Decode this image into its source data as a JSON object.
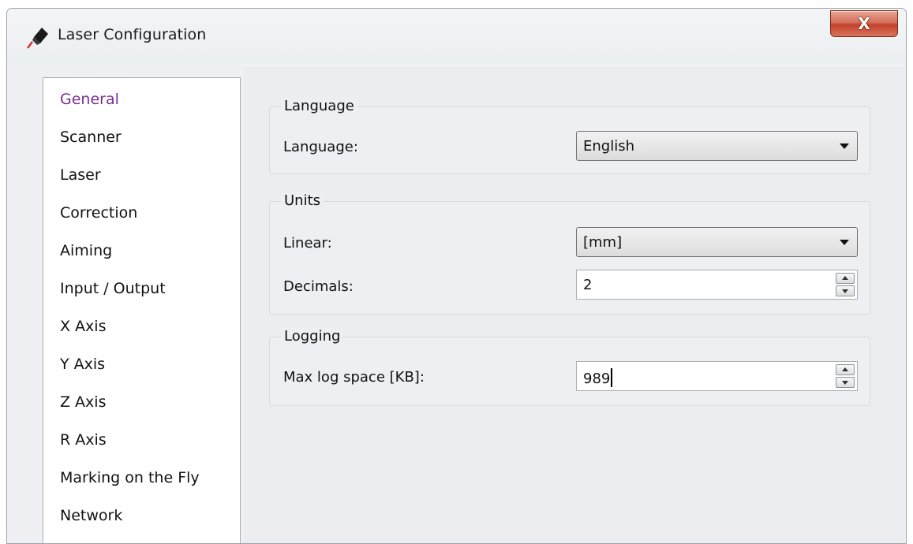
{
  "window": {
    "title": "Laser Configuration",
    "close_label": "X"
  },
  "nav": {
    "items": [
      {
        "label": "General",
        "selected": true
      },
      {
        "label": "Scanner"
      },
      {
        "label": "Laser"
      },
      {
        "label": "Correction"
      },
      {
        "label": "Aiming"
      },
      {
        "label": "Input / Output"
      },
      {
        "label": "X Axis"
      },
      {
        "label": "Y Axis"
      },
      {
        "label": "Z Axis"
      },
      {
        "label": "R Axis"
      },
      {
        "label": "Marking on the Fly"
      },
      {
        "label": "Network"
      }
    ]
  },
  "language_group": {
    "title": "Language",
    "language_label": "Language:",
    "language_value": "English"
  },
  "units_group": {
    "title": "Units",
    "linear_label": "Linear:",
    "linear_value": "[mm]",
    "decimals_label": "Decimals:",
    "decimals_value": "2"
  },
  "logging_group": {
    "title": "Logging",
    "max_log_label": "Max log space [KB]:",
    "max_log_value": "989"
  },
  "colors": {
    "selected_nav_text": "#7a2f8f",
    "close_button": "#c2412a"
  },
  "icons": {
    "title_icon": "laser-pen-icon",
    "combo_arrow": "chevron-down-icon",
    "spin_up": "spin-up-icon",
    "spin_down": "spin-down-icon"
  }
}
